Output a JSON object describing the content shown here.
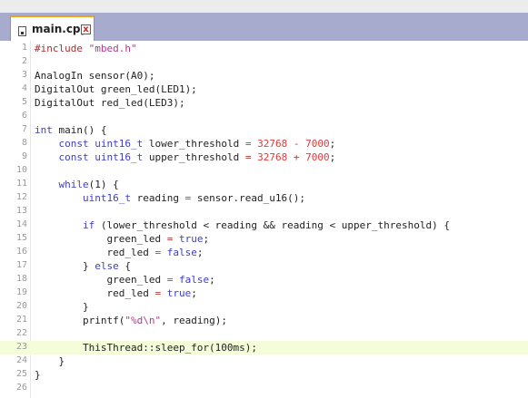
{
  "tab": {
    "filename": "main.cpp",
    "close_glyph": "x",
    "file_icon": "cpp-file-icon"
  },
  "colors": {
    "tabbar": "#a7abcd",
    "tab_accent": "#f0a21a",
    "current_line": "#f4fcd9",
    "keyword": "#3d3dc8",
    "string": "#b03a8c",
    "number": "#e03a3a"
  },
  "current_line": 23,
  "lines": [
    {
      "n": "1",
      "segs": [
        [
          "#include ",
          "pp"
        ],
        [
          "\"mbed.h\"",
          "str"
        ]
      ]
    },
    {
      "n": "2",
      "segs": []
    },
    {
      "n": "3",
      "segs": [
        [
          "AnalogIn sensor(A0);",
          ""
        ]
      ]
    },
    {
      "n": "4",
      "segs": [
        [
          "DigitalOut green_led(LED1);",
          ""
        ]
      ]
    },
    {
      "n": "5",
      "segs": [
        [
          "DigitalOut red_led(LED3);",
          ""
        ]
      ]
    },
    {
      "n": "6",
      "segs": []
    },
    {
      "n": "7",
      "segs": [
        [
          "int",
          "kw"
        ],
        [
          " main() {",
          ""
        ]
      ]
    },
    {
      "n": "8",
      "segs": [
        [
          "    ",
          ""
        ],
        [
          "const",
          "kw"
        ],
        [
          " ",
          ""
        ],
        [
          "uint16_t",
          "kw"
        ],
        [
          " lower_threshold ",
          ""
        ],
        [
          "=",
          "op"
        ],
        [
          " ",
          ""
        ],
        [
          "32768",
          "num"
        ],
        [
          " ",
          ""
        ],
        [
          "-",
          "op"
        ],
        [
          " ",
          ""
        ],
        [
          "7000",
          "num"
        ],
        [
          ";",
          ""
        ]
      ]
    },
    {
      "n": "9",
      "segs": [
        [
          "    ",
          ""
        ],
        [
          "const",
          "kw"
        ],
        [
          " ",
          ""
        ],
        [
          "uint16_t",
          "kw"
        ],
        [
          " upper_threshold ",
          ""
        ],
        [
          "=",
          "op"
        ],
        [
          " ",
          ""
        ],
        [
          "32768",
          "num"
        ],
        [
          " ",
          ""
        ],
        [
          "+",
          "op"
        ],
        [
          " ",
          ""
        ],
        [
          "7000",
          "num"
        ],
        [
          ";",
          ""
        ]
      ]
    },
    {
      "n": "10",
      "segs": []
    },
    {
      "n": "11",
      "segs": [
        [
          "    ",
          ""
        ],
        [
          "while",
          "kw"
        ],
        [
          "(1) {",
          ""
        ]
      ]
    },
    {
      "n": "12",
      "segs": [
        [
          "        ",
          ""
        ],
        [
          "uint16_t",
          "kw"
        ],
        [
          " reading ",
          ""
        ],
        [
          "=",
          "op"
        ],
        [
          " sensor.read_u16();",
          ""
        ]
      ]
    },
    {
      "n": "13",
      "segs": []
    },
    {
      "n": "14",
      "segs": [
        [
          "        ",
          ""
        ],
        [
          "if",
          "kw"
        ],
        [
          " (lower_threshold < reading && reading < upper_threshold) {",
          ""
        ]
      ]
    },
    {
      "n": "15",
      "segs": [
        [
          "            green_led ",
          ""
        ],
        [
          "=",
          "op"
        ],
        [
          " ",
          ""
        ],
        [
          "true",
          "kw"
        ],
        [
          ";",
          ""
        ]
      ]
    },
    {
      "n": "16",
      "segs": [
        [
          "            red_led ",
          ""
        ],
        [
          "=",
          "op"
        ],
        [
          " ",
          ""
        ],
        [
          "false",
          "kw"
        ],
        [
          ";",
          ""
        ]
      ]
    },
    {
      "n": "17",
      "segs": [
        [
          "        } ",
          ""
        ],
        [
          "else",
          "kw"
        ],
        [
          " {",
          ""
        ]
      ]
    },
    {
      "n": "18",
      "segs": [
        [
          "            green_led ",
          ""
        ],
        [
          "=",
          "op"
        ],
        [
          " ",
          ""
        ],
        [
          "false",
          "kw"
        ],
        [
          ";",
          ""
        ]
      ]
    },
    {
      "n": "19",
      "segs": [
        [
          "            red_led ",
          ""
        ],
        [
          "=",
          "op"
        ],
        [
          " ",
          ""
        ],
        [
          "true",
          "kw"
        ],
        [
          ";",
          ""
        ]
      ]
    },
    {
      "n": "20",
      "segs": [
        [
          "        }",
          ""
        ]
      ]
    },
    {
      "n": "21",
      "segs": [
        [
          "        printf(",
          ""
        ],
        [
          "\"%d\\n\"",
          "str"
        ],
        [
          ", reading);",
          ""
        ]
      ]
    },
    {
      "n": "22",
      "segs": []
    },
    {
      "n": "23",
      "segs": [
        [
          "        ThisThread::sleep_for(100ms);",
          ""
        ]
      ]
    },
    {
      "n": "24",
      "segs": [
        [
          "    }",
          ""
        ]
      ]
    },
    {
      "n": "25",
      "segs": [
        [
          "}",
          ""
        ]
      ]
    },
    {
      "n": "26",
      "segs": []
    }
  ]
}
